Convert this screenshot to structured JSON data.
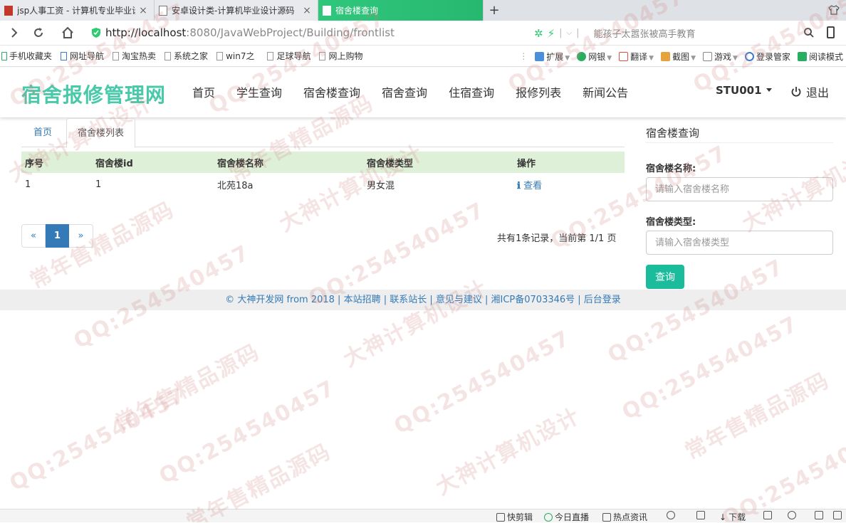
{
  "browser": {
    "tabs": [
      {
        "title": "jsp人事工资 - 计算机专业毕业设",
        "close": "×"
      },
      {
        "title": "安卓设计类-计算机毕业设计源码",
        "close": "×"
      },
      {
        "title": "宿舍楼查询",
        "close": "×"
      }
    ],
    "new_tab": "+",
    "url_host": "http://localhost",
    "url_path": ":8080/JavaWebProject/Building/frontlist",
    "search_hint": "能孩子太嚣张被高手教育",
    "bookmarks": [
      "手机收藏夹",
      "网址导航",
      "淘宝热卖",
      "系统之家",
      "win7之",
      "足球导航",
      "网上购物"
    ],
    "bookmark_tools": [
      "扩展",
      "网银",
      "翻译",
      "截图",
      "游戏",
      "登录管家",
      "阅读模式"
    ]
  },
  "site": {
    "brand": "宿舍报修管理网",
    "menu": [
      "首页",
      "学生查询",
      "宿舍楼查询",
      "宿舍查询",
      "住宿查询",
      "报修列表",
      "新闻公告"
    ],
    "user": "STU001",
    "logout": "退出"
  },
  "content": {
    "tabs": [
      "首页",
      "宿舍楼列表"
    ],
    "table": {
      "headers": [
        "序号",
        "宿舍楼id",
        "宿舍楼名称",
        "宿舍楼类型",
        "操作"
      ],
      "rows": [
        {
          "no": "1",
          "id": "1",
          "name": "北苑18a",
          "type": "男女混",
          "action": "查看"
        }
      ]
    },
    "pager": {
      "prev": "«",
      "current": "1",
      "next": "»"
    },
    "summary": "共有1条记录，当前第 1/1 页"
  },
  "sidebar": {
    "title": "宿舍楼查询",
    "name_label": "宿舍楼名称:",
    "name_placeholder": "请输入宿舍楼名称",
    "type_label": "宿舍楼类型:",
    "type_placeholder": "请输入宿舍楼类型",
    "query_button": "查询"
  },
  "footer": "© 大神开发网 from 2018 | 本站招聘 | 联系站长 | 意见与建议 | 湘ICP备0703346号 | 后台登录",
  "statusbar": [
    "快剪辑",
    "今日直播",
    "热点资讯",
    "下载"
  ],
  "watermarks": [
    "QQ:254540457",
    "大神计算机设计",
    "常年售精品源码"
  ]
}
